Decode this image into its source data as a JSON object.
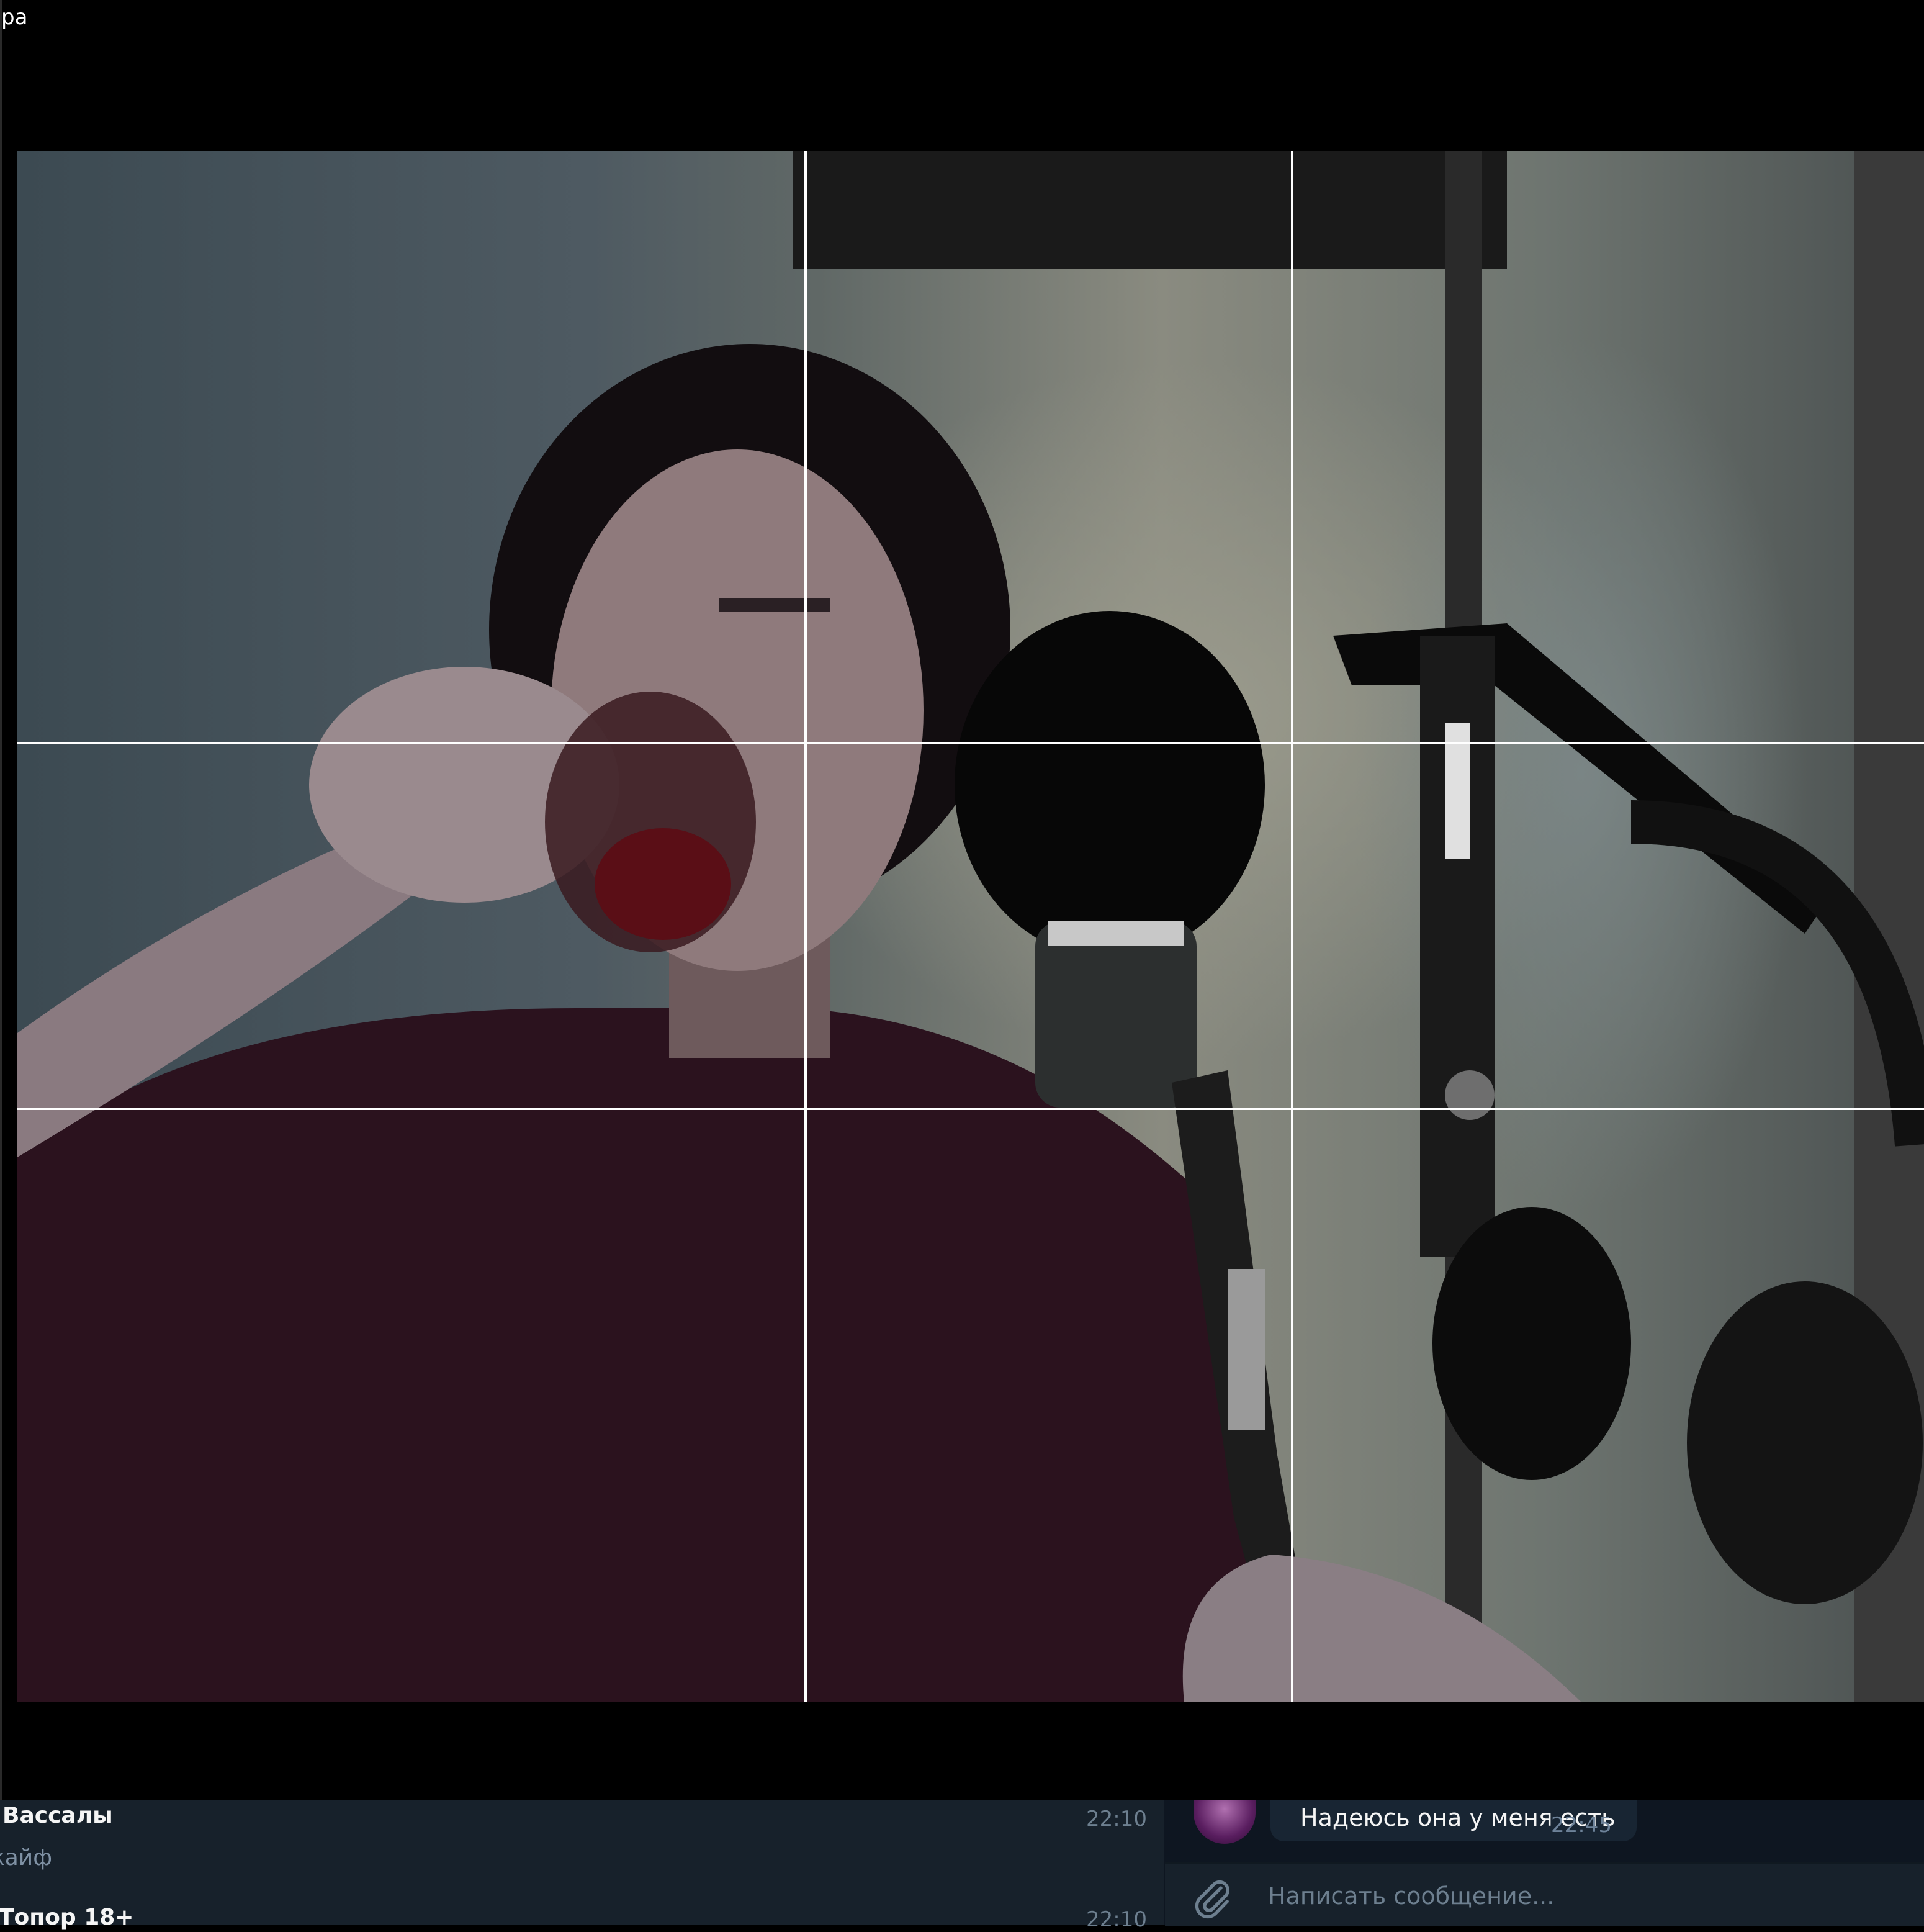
{
  "window": {
    "title": "ра"
  },
  "camera": {
    "overlay": "rule-of-thirds-grid",
    "frame_color": "#000000"
  },
  "chat_list": {
    "items": [
      {
        "name": "Вассалы",
        "preview": "кайф",
        "time": "22:10"
      },
      {
        "name": "Топор 18+",
        "preview": "",
        "time": "22:10"
      }
    ]
  },
  "conversation": {
    "last_message": {
      "text": "Надеюсь она у меня есть",
      "time": "22:45"
    },
    "composer": {
      "placeholder": "Написать сообщение..."
    }
  },
  "colors": {
    "sidebar_bg": "#17212b",
    "chat_bg": "#0e1621",
    "bubble_bg": "#182533",
    "muted_text": "#6d7f8f"
  },
  "icons": {
    "attach": "paperclip-icon"
  }
}
